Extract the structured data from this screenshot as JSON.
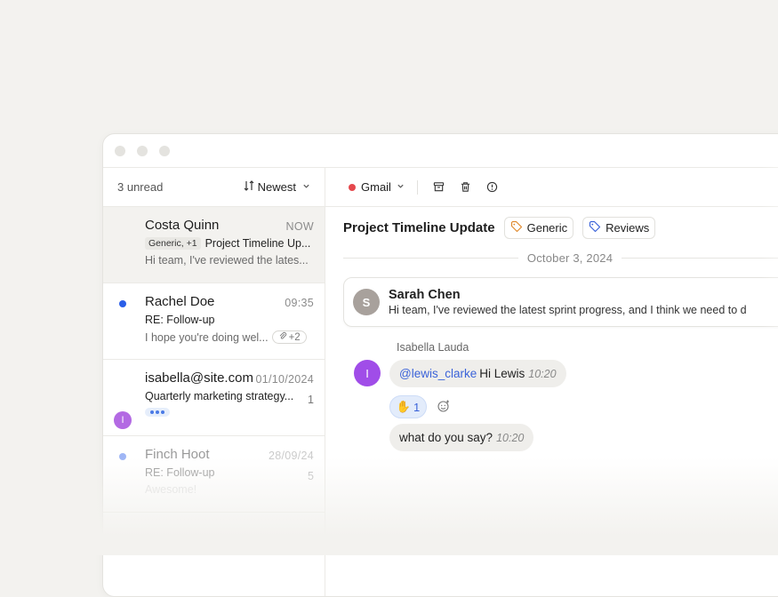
{
  "sidebar": {
    "unread_label": "3 unread",
    "sort_label": "Newest",
    "emails": [
      {
        "sender": "Costa Quinn",
        "time": "NOW",
        "tag": "Generic, +1",
        "subject": "Project Timeline Up...",
        "preview": "Hi team, I've reviewed the lates..."
      },
      {
        "sender": "Rachel Doe",
        "time": "09:35",
        "subject": "RE: Follow-up",
        "preview": "I hope you're doing wel...",
        "attachments": "+2"
      },
      {
        "sender": "isabella@site.com",
        "time": "01/10/2024",
        "subject": "Quarterly marketing strategy...",
        "count": "1",
        "avatar_initial": "I"
      },
      {
        "sender": "Finch Hoot",
        "time": "28/09/24",
        "subject": "RE: Follow-up",
        "count": "5",
        "preview": "Awesome!"
      }
    ]
  },
  "toolbar": {
    "account_label": "Gmail"
  },
  "thread": {
    "title": "Project Timeline Update",
    "labels": [
      "Generic",
      "Reviews"
    ],
    "date": "October 3, 2024",
    "message": {
      "avatar_initial": "S",
      "sender": "Sarah Chen",
      "text": "Hi team, I've reviewed the latest sprint progress, and I think we need to d"
    },
    "chat": {
      "author": "Isabella Lauda",
      "avatar_initial": "I",
      "bubble1": {
        "mention": "@lewis_clarke",
        "text": "Hi Lewis",
        "time": "10:20"
      },
      "reaction": {
        "emoji": "✋",
        "count": "1"
      },
      "bubble2": {
        "text": "what do you say?",
        "time": "10:20"
      }
    }
  },
  "colors": {
    "unread": "#2a5ee8",
    "gmail": "#e5484d",
    "generic_tag": "#e08a2e",
    "reviews_tag": "#3b63d9",
    "mention": "#3b63d9"
  }
}
